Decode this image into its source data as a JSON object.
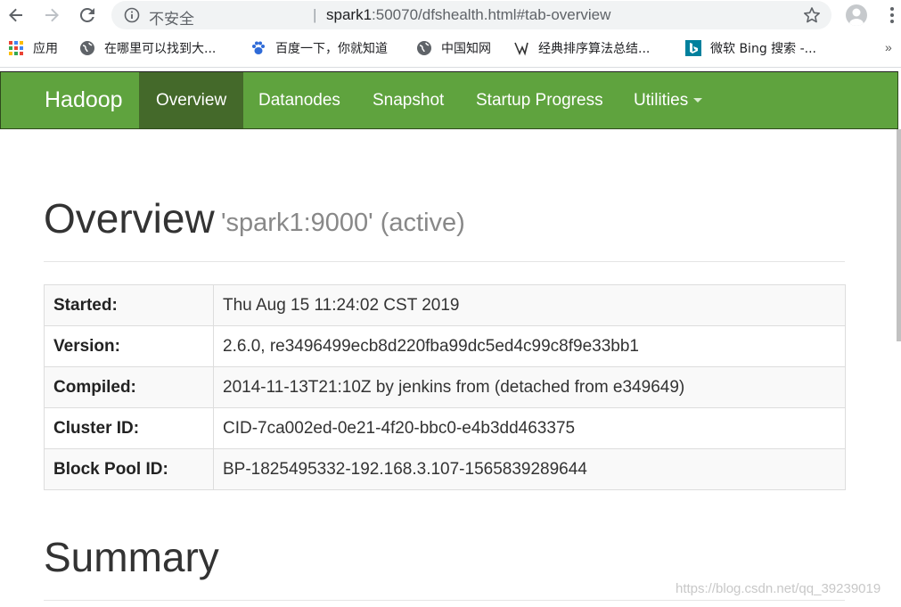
{
  "browser": {
    "insecure_label": "不安全",
    "separator": "|",
    "url_host": "spark1",
    "url_rest": ":50070/dfshealth.html#tab-overview",
    "bookmarks": [
      {
        "label": "应用",
        "icon": "apps-grid-icon"
      },
      {
        "label": "在哪里可以找到大...",
        "icon": "globe-icon"
      },
      {
        "label": "百度一下，你就知道",
        "icon": "baidu-paw-icon"
      },
      {
        "label": "中国知网",
        "icon": "globe-icon"
      },
      {
        "label": "经典排序算法总结...",
        "icon": "algorithm-icon"
      },
      {
        "label": "微软 Bing 搜索 -...",
        "icon": "bing-icon"
      }
    ],
    "more_bookmarks": "»"
  },
  "navbar": {
    "brand": "Hadoop",
    "items": [
      {
        "label": "Overview",
        "active": true
      },
      {
        "label": "Datanodes"
      },
      {
        "label": "Snapshot"
      },
      {
        "label": "Startup Progress"
      },
      {
        "label": "Utilities",
        "dropdown": true
      }
    ],
    "color": "#5fa33e",
    "active_color": "#44692a"
  },
  "overview": {
    "title": "Overview",
    "subtitle": "'spark1:9000' (active)",
    "rows": [
      {
        "key": "Started:",
        "value": "Thu Aug 15 11:24:02 CST 2019"
      },
      {
        "key": "Version:",
        "value": "2.6.0, re3496499ecb8d220fba99dc5ed4c99c8f9e33bb1"
      },
      {
        "key": "Compiled:",
        "value": "2014-11-13T21:10Z by jenkins from (detached from e349649)"
      },
      {
        "key": "Cluster ID:",
        "value": "CID-7ca002ed-0e21-4f20-bbc0-e4b3dd463375"
      },
      {
        "key": "Block Pool ID:",
        "value": "BP-1825495332-192.168.3.107-1565839289644"
      }
    ]
  },
  "summary": {
    "title": "Summary"
  },
  "watermark": "https://blog.csdn.net/qq_39239019"
}
